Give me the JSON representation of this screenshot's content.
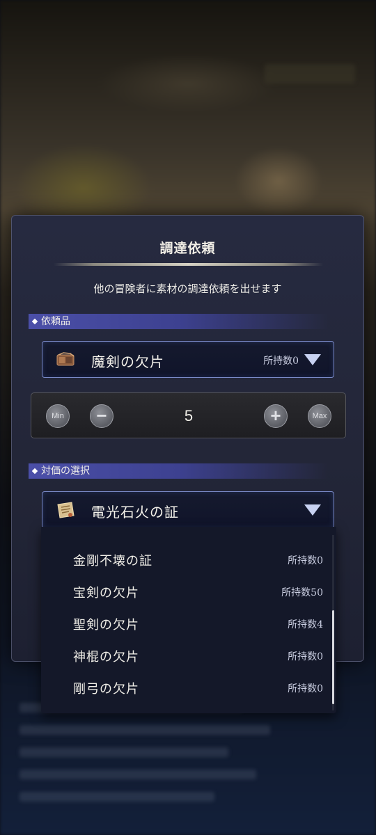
{
  "dialog": {
    "title": "調達依頼",
    "description": "他の冒険者に素材の調達依頼を出せます"
  },
  "request_item": {
    "section_label": "依頼品",
    "selected_name": "魔剣の欠片",
    "owned_text": "所持数0",
    "icon": "sword-fragment-icon"
  },
  "quantity": {
    "min_label": "Min",
    "max_label": "Max",
    "value": "5"
  },
  "reward": {
    "section_label": "対価の選択",
    "selected_name": "電光石火の証",
    "icon": "certificate-scroll-icon"
  },
  "reward_options": [
    {
      "name": "金剛不壊の証",
      "owned": "所持数0"
    },
    {
      "name": "宝剣の欠片",
      "owned": "所持数50"
    },
    {
      "name": "聖剣の欠片",
      "owned": "所持数4"
    },
    {
      "name": "神棍の欠片",
      "owned": "所持数0"
    },
    {
      "name": "剛弓の欠片",
      "owned": "所持数0"
    }
  ],
  "colors": {
    "section_header": "#4b4fa8",
    "select_border": "#7a8ac8",
    "panel_bg": "#262a40"
  }
}
